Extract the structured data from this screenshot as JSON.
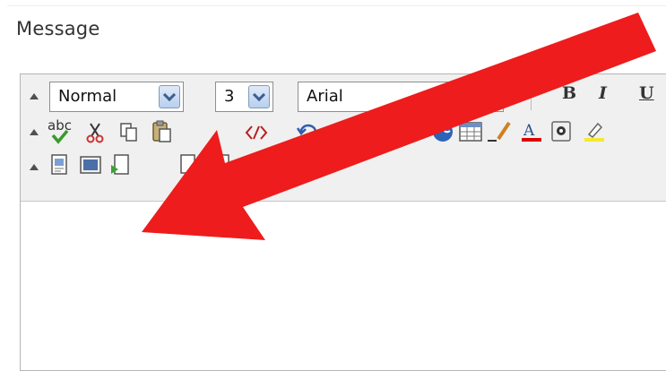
{
  "form": {
    "message_label": "Message"
  },
  "toolbar": {
    "format_select": {
      "value": "Normal"
    },
    "size_select": {
      "value": "3"
    },
    "font_select": {
      "value": "Arial"
    },
    "bold_label": "B",
    "italic_label": "I",
    "underline_label": "U",
    "spellcheck_label": "abc"
  },
  "annotation": {
    "arrow_color": "#ee1c1c"
  }
}
